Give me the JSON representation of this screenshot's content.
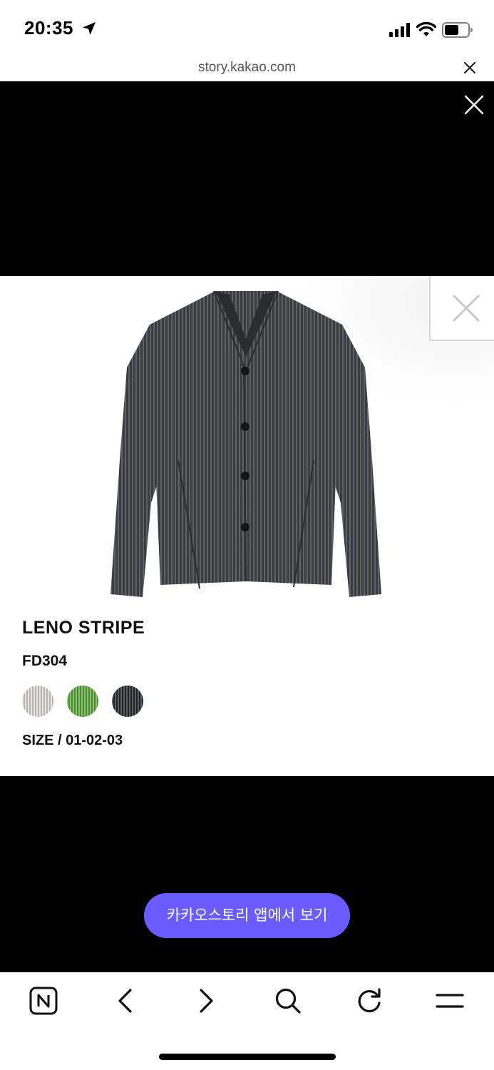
{
  "status_bar": {
    "time": "20:35",
    "icons": [
      "location-arrow-icon",
      "cellular-signal-icon",
      "wifi-icon",
      "battery-icon"
    ]
  },
  "browser": {
    "url": "story.kakao.com",
    "close_icon": "close-icon"
  },
  "viewer": {
    "close_icon": "close-icon"
  },
  "ad": {
    "close_icon": "close-icon",
    "product_name": "LENO STRIPE",
    "product_code": "FD304",
    "swatches": [
      "light-gray-stripe",
      "green-stripe",
      "dark-gray-stripe"
    ],
    "size_text": "SIZE / 01-02-03"
  },
  "cta": {
    "label": "카카오스토리 앱에서 보기",
    "color": "#6a5cff"
  },
  "toolbar": {
    "icons": [
      "naver-home-icon",
      "back-icon",
      "forward-icon",
      "search-icon",
      "reload-icon",
      "menu-icon"
    ]
  }
}
